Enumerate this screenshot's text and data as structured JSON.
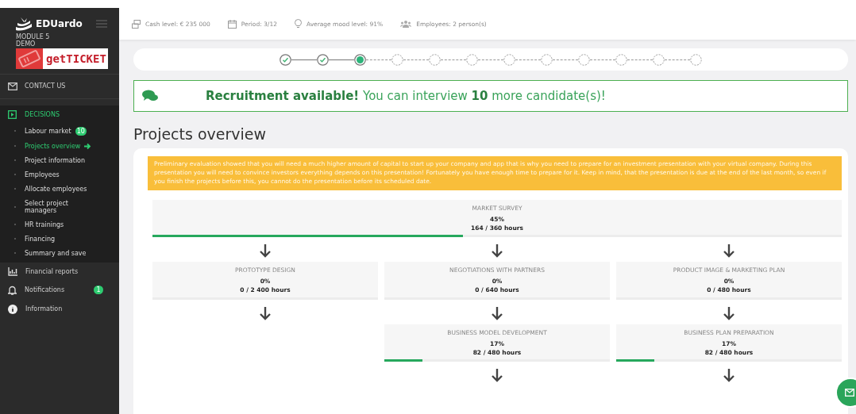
{
  "sidebar": {
    "brand": "EDUardo",
    "module": "MODULE 5\nDEMO",
    "logo_text": "getTICKET",
    "contact": "CONTACT US",
    "sections": [
      {
        "label": "DECISIONS",
        "expanded": true,
        "selected": true,
        "children": [
          {
            "label": "Labour market",
            "selected": false,
            "badge": "10"
          },
          {
            "label": "Projects overview",
            "selected": true
          },
          {
            "label": "Project information",
            "selected": false
          },
          {
            "label": "Employees",
            "selected": false
          },
          {
            "label": "Allocate employees",
            "selected": false
          },
          {
            "label": "Select project managers",
            "selected": false
          },
          {
            "label": "HR trainings",
            "selected": false
          },
          {
            "label": "Financing",
            "selected": false
          },
          {
            "label": "Summary and save",
            "selected": false
          }
        ]
      },
      {
        "label": "Financial reports",
        "expanded": false,
        "selected": false
      },
      {
        "label": "Notifications",
        "expanded": false,
        "selected": false,
        "badge": "1"
      },
      {
        "label": "Information",
        "expanded": false,
        "selected": false
      }
    ]
  },
  "status_bar": [
    "Cash level: € 235 000",
    "Period: 3/12",
    "Average mood level: 91%",
    "Employees: 2 person(s)"
  ],
  "stepper": [
    {
      "done": true,
      "selected": false
    },
    {
      "done": true,
      "selected": false
    },
    {
      "done": false,
      "selected": true
    },
    {
      "done": false,
      "selected": false
    },
    {
      "done": false,
      "selected": false
    },
    {
      "done": false,
      "selected": false
    },
    {
      "done": false,
      "selected": false
    },
    {
      "done": false,
      "selected": false
    },
    {
      "done": false,
      "selected": false
    },
    {
      "done": false,
      "selected": false
    },
    {
      "done": false,
      "selected": false
    },
    {
      "done": false,
      "selected": false
    }
  ],
  "banner": "**Recruitment available!** You can interview **10** more candidate(s)!",
  "heading": "Projects overview",
  "notice": "Preliminary evaluation showed that you will need a much higher amount of capital to start up your company and app that is why you need to prepare for an investment presentation with your virtual company. During this presentation you will need to convince investors everything depends on this presentation! Fortunately you have enough time to prepare for it. Keep in mind, that the presentation is due at the end of the last month, so even if you finish the projects before this, you cannot do the presentation before its scheduled date.",
  "top_project": {
    "name": "MARKET SURVEY",
    "percent": "45%",
    "hours": "164 / 360 hours",
    "level": 0.45
  },
  "columns": [
    {
      "projects": [
        {
          "name": "PROTOTYPE DESIGN",
          "percent": "0%",
          "hours": "0 / 2 400 hours"
        }
      ]
    },
    {
      "projects": [
        {
          "name": "NEGOTIATIONS WITH PARTNERS",
          "percent": "0%",
          "hours": "0 / 640 hours"
        },
        {
          "name": "BUSINESS MODEL DEVELOPMENT",
          "percent": "17%",
          "hours": "82 / 480 hours",
          "level": 0.17
        }
      ]
    },
    {
      "projects": [
        {
          "name": "PRODUCT IMAGE & MARKETING PLAN",
          "percent": "0%",
          "hours": "0 / 480 hours"
        },
        {
          "name": "BUSINESS PLAN PREPARATION",
          "percent": "17%",
          "hours": "82 / 480 hours",
          "level": 0.17
        }
      ]
    }
  ]
}
